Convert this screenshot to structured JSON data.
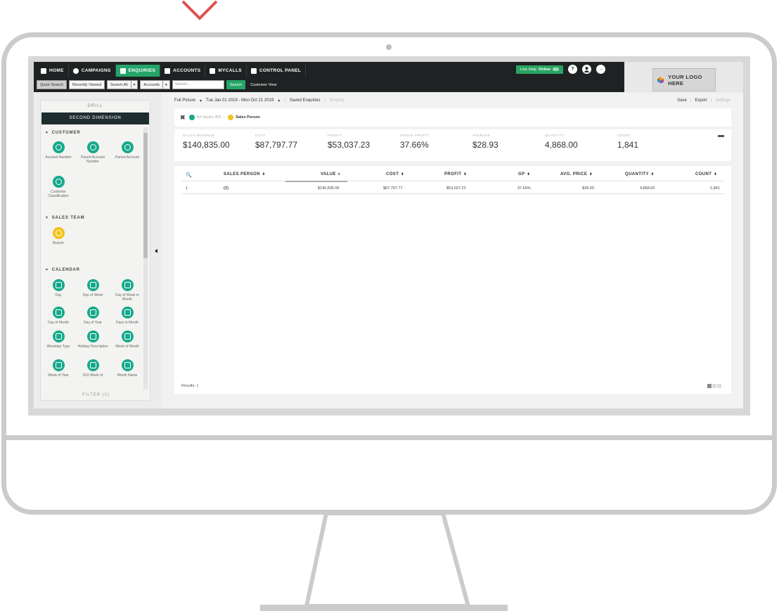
{
  "nav": {
    "items": [
      {
        "label": "HOME",
        "icon": "home-icon"
      },
      {
        "label": "CAMPAIGNS",
        "icon": "campaigns-icon"
      },
      {
        "label": "ENQUIRIES",
        "icon": "enquiries-icon",
        "active": true
      },
      {
        "label": "ACCOUNTS",
        "icon": "bank-icon"
      },
      {
        "label": "MYCALLS",
        "icon": "calls-icon"
      },
      {
        "label": "CONTROL PANEL",
        "icon": "control-panel-icon"
      }
    ],
    "live_help_prefix": "Live Help",
    "live_help_status": "Online",
    "help_glyph": "?",
    "logout_glyph": "→"
  },
  "subbar": {
    "quick_search": "Quick Search",
    "recently_viewed": "Recently Viewed",
    "search_all": "Search All",
    "accounts": "Accounts",
    "dropdown_glyph": "▾",
    "search_placeholder": "Search...",
    "search_button": "Search",
    "customer_view": "Customer View"
  },
  "logo": {
    "text": "YOUR LOGO HERE"
  },
  "sidebar": {
    "drill": "DRILL",
    "second_dimension": "SECOND DIMENSION",
    "filter": "FILTER (0)",
    "sections": [
      {
        "title": "CUSTOMER",
        "items": [
          "Account Number",
          "Parent Account Number",
          "Parent Account",
          "Customer Classification"
        ]
      },
      {
        "title": "SALES TEAM",
        "items": [
          "Branch"
        ]
      },
      {
        "title": "CALENDAR",
        "items": [
          "Day",
          "Day of Week",
          "Day of Week in Month",
          "Day of Month",
          "Day of Year",
          "Days in Month",
          "Weekday Type",
          "Holiday Description",
          "Week of Month",
          "Week of Year",
          "ISO Week of",
          "Month Name"
        ]
      }
    ]
  },
  "toolbar": {
    "full_picture": "Full Picture",
    "date_range": "Tue Jan 01 2019 - Mon Oct 21 2019",
    "saved_enquiries": "Saved Enquiries",
    "enquiry": "Enquiry",
    "save": "Save",
    "export": "Export",
    "settings": "Settings",
    "dropdown_glyph": "▾",
    "separator": "|"
  },
  "breadcrumb": {
    "close_glyph": "✖",
    "parent": "Art Studio 356",
    "separator": "›",
    "current": "Sales Person"
  },
  "kpis": [
    {
      "label": "SALES REVENUE",
      "value": "$140,835.00"
    },
    {
      "label": "COST",
      "value": "$87,797.77"
    },
    {
      "label": "PROFIT",
      "value": "$53,037.23"
    },
    {
      "label": "GROSS PROFIT",
      "value": "37.66%"
    },
    {
      "label": "AVERAGE",
      "value": "$28.93"
    },
    {
      "label": "QUANTITY",
      "value": "4,868.00"
    },
    {
      "label": "COUNT",
      "value": "1,841"
    }
  ],
  "table": {
    "sort_glyph": "⬍",
    "sort_active_glyph": "▾",
    "search_glyph": "🔍",
    "headers": [
      "SALES PERSON",
      "VALUE",
      "COST",
      "PROFIT",
      "GP",
      "AVG. PRICE",
      "QUANTITY",
      "COUNT"
    ],
    "rows": [
      [
        "1",
        "(Z)",
        "$140,835.00",
        "$87,797.77",
        "$53,037.23",
        "37.66%",
        "$28.93",
        "4,868.00",
        "1,841"
      ]
    ],
    "results": "Results: 1"
  }
}
